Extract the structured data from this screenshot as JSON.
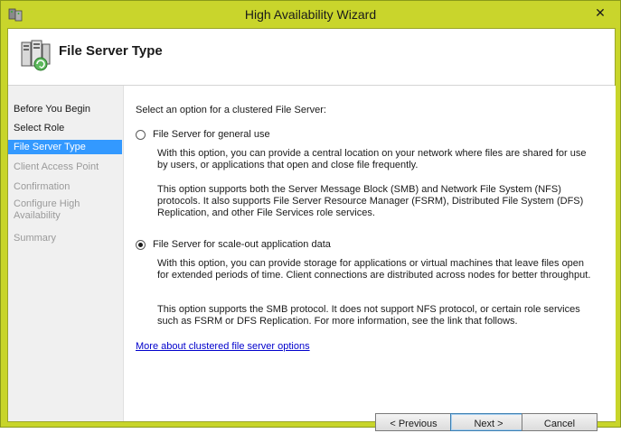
{
  "window": {
    "title": "High Availability Wizard",
    "close_glyph": "✕"
  },
  "header": {
    "title": "File Server Type",
    "icon": "file-server-cluster-icon"
  },
  "sidebar": {
    "items": [
      {
        "label": "Before You Begin",
        "state": "normal"
      },
      {
        "label": "Select Role",
        "state": "normal"
      },
      {
        "label": "File Server Type",
        "state": "active"
      },
      {
        "label": "Client Access Point",
        "state": "disabled"
      },
      {
        "label": "Confirmation",
        "state": "disabled"
      },
      {
        "label": "Configure High Availability",
        "state": "disabled"
      },
      {
        "label": "Summary",
        "state": "disabled"
      }
    ]
  },
  "main": {
    "intro": "Select an option for a clustered File Server:",
    "options": [
      {
        "label": "File Server for general use",
        "checked": false,
        "desc1": "With this option, you can provide a central location on your network where files are shared for use by users, or applications that open and close file frequently.",
        "desc2": "This option supports both the Server Message Block (SMB) and Network File System (NFS) protocols. It also supports File Server Resource Manager (FSRM), Distributed File System (DFS) Replication, and other File Services role services."
      },
      {
        "label": "File Server for scale-out application data",
        "checked": true,
        "desc1": "With this option, you can provide storage for applications or virtual machines that leave files open for extended periods of time. Client connections are distributed across nodes for better throughput.",
        "desc2": "This option supports the SMB protocol. It does not support NFS protocol, or certain role services such as FSRM or DFS Replication. For more information, see the link that follows."
      }
    ],
    "link": "More about clustered file server options"
  },
  "buttons": {
    "previous": "< Previous",
    "next": "Next >",
    "cancel": "Cancel"
  },
  "colors": {
    "titlebar": "#c9d52c",
    "selection": "#3399ff",
    "link": "#0000cc"
  }
}
